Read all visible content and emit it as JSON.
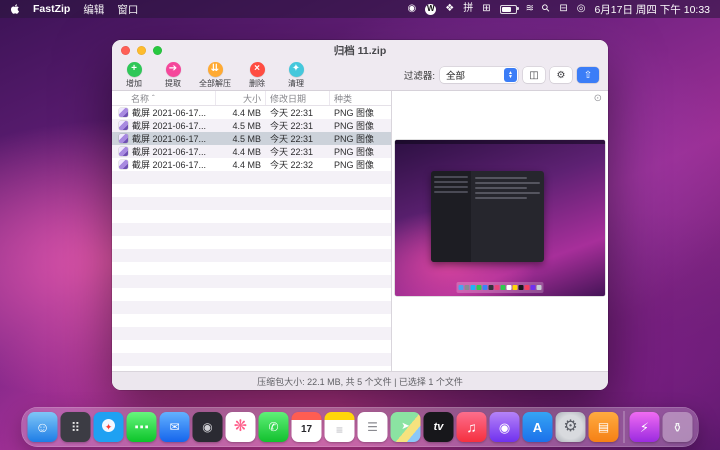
{
  "menubar": {
    "app_name": "FastZip",
    "menus": [
      "编辑",
      "窗口"
    ],
    "status_icons": [
      {
        "name": "recording-icon",
        "glyph": "◉"
      },
      {
        "name": "wikipedia-icon",
        "glyph": "W"
      },
      {
        "name": "shortcuts-icon",
        "glyph": "❖"
      },
      {
        "name": "input-method-icon",
        "glyph": "拼"
      },
      {
        "name": "screen-mirroring-icon",
        "glyph": "⊞"
      },
      {
        "name": "wifi-icon",
        "glyph": "≋"
      },
      {
        "name": "spotlight-icon",
        "glyph": "⚲"
      },
      {
        "name": "control-center-icon",
        "glyph": "⊟"
      },
      {
        "name": "siri-icon",
        "glyph": "◎"
      }
    ],
    "clock": "6月17日 周四 下午 10:33"
  },
  "window": {
    "title": "归档 11.zip",
    "toolbar": {
      "buttons": [
        {
          "label": "增加",
          "glyph": "+",
          "style": "background:#2fc758"
        },
        {
          "label": "提取",
          "glyph": "➔",
          "style": "background:#f5479b"
        },
        {
          "label": "全部解压",
          "glyph": "⇊",
          "style": "background:#ffaa33"
        },
        {
          "label": "删除",
          "glyph": "×",
          "style": "background:#ff4d42"
        },
        {
          "label": "清理",
          "glyph": "✦",
          "style": "background:#45c8dc"
        }
      ],
      "filter_label": "过滤器:",
      "filter_value": "全部",
      "view_glyph": "◫",
      "settings_glyph": "⚙",
      "share_glyph": "⇧"
    },
    "table": {
      "columns": [
        "名称",
        "大小",
        "修改日期",
        "种类"
      ],
      "sort_indicator": "ˆ",
      "rows": [
        {
          "name": "截屏 2021-06-17...",
          "size": "4.4 MB",
          "date": "今天 22:31",
          "kind": "PNG 图像"
        },
        {
          "name": "截屏 2021-06-17...",
          "size": "4.5 MB",
          "date": "今天 22:31",
          "kind": "PNG 图像"
        },
        {
          "name": "截屏 2021-06-17...",
          "size": "4.5 MB",
          "date": "今天 22:31",
          "kind": "PNG 图像"
        },
        {
          "name": "截屏 2021-06-17...",
          "size": "4.4 MB",
          "date": "今天 22:31",
          "kind": "PNG 图像"
        },
        {
          "name": "截屏 2021-06-17...",
          "size": "4.4 MB",
          "date": "今天 22:32",
          "kind": "PNG 图像"
        }
      ]
    },
    "preview": {
      "eye_glyph": "⊙"
    },
    "status": "压缩包大小: 22.1 MB, 共 5 个文件 | 已选择 1 个文件"
  },
  "dock": {
    "items": [
      {
        "name": "finder",
        "glyph": "☺",
        "style": "background:linear-gradient(180deg,#7fc6f7,#1e7de6)"
      },
      {
        "name": "launchpad",
        "glyph": "⠿",
        "style": "background:#3c3c44;color:#e8e8e8;font-size:13px"
      },
      {
        "name": "safari",
        "glyph": "✦",
        "style": "background:radial-gradient(circle at 50% 45%,#f2f8ff 0 28%,#1fa1f2 30%);color:#ff3b30;font-size:9px"
      },
      {
        "name": "messages",
        "glyph": "⋯",
        "style": "background:linear-gradient(180deg,#67f57d,#0cc42a);font-size:15px;font-weight:700"
      },
      {
        "name": "mail",
        "glyph": "✉",
        "style": "background:linear-gradient(180deg,#63b1ff,#1565ec);font-size:12px"
      },
      {
        "name": "screenshot",
        "glyph": "◉",
        "style": "background:#2a2a32;color:#cfcfd4;font-size:12px"
      },
      {
        "name": "photos",
        "glyph": "❋",
        "style": "background:#fff;color:#ff5e8a;font-size:16px"
      },
      {
        "name": "facetime",
        "glyph": "✆",
        "style": "background:linear-gradient(180deg,#5ff078,#12c02e);font-size:12px"
      },
      {
        "name": "calendar",
        "glyph": "17",
        "style": "background:linear-gradient(180deg,#ff5d52 0 8px,#fff 8px);color:#26262b"
      },
      {
        "name": "notes",
        "glyph": "≡",
        "style": "background:linear-gradient(180deg,#ffd60a 0 8px,#fff 8px);color:#b9b9bf;font-size:12px"
      },
      {
        "name": "reminders",
        "glyph": "☰",
        "style": "background:#fff;color:#8a8a90;font-size:12px"
      },
      {
        "name": "maps",
        "glyph": "➤",
        "style": "background:linear-gradient(130deg,#8be3a2 0 55%,#f6e27e 55% 75%,#8cc8f8 75%);font-size:10px"
      },
      {
        "name": "tv",
        "glyph": "tv",
        "style": "background:#17171b;font-size:11px;font-weight:700"
      },
      {
        "name": "music",
        "glyph": "♫",
        "style": "background:linear-gradient(180deg,#fd6e8c,#f5303f);font-size:14px"
      },
      {
        "name": "podcasts",
        "glyph": "◉",
        "style": "background:linear-gradient(180deg,#b583f8,#7031ef);font-size:13px"
      },
      {
        "name": "app-store",
        "glyph": "A",
        "style": "background:linear-gradient(180deg,#35a4f4,#1c71ea);font-weight:700;font-size:13px"
      },
      {
        "name": "settings",
        "glyph": "⚙",
        "style": "background:radial-gradient(circle,#d8dade 0 55%,#a6abb3 100%);color:#5b5e66;font-size:16px"
      },
      {
        "name": "books",
        "glyph": "▤",
        "style": "background:linear-gradient(180deg,#ffab40,#f58015);font-size:12px"
      },
      {
        "name": "fastzip",
        "glyph": "⚡",
        "style": "background:linear-gradient(180deg,#f06bf2,#9b2be0);font-size:13px"
      },
      {
        "name": "trash",
        "glyph": "⚱",
        "style": "background:rgba(255,255,255,.32);color:#f4f4f6;font-size:13px"
      }
    ]
  }
}
